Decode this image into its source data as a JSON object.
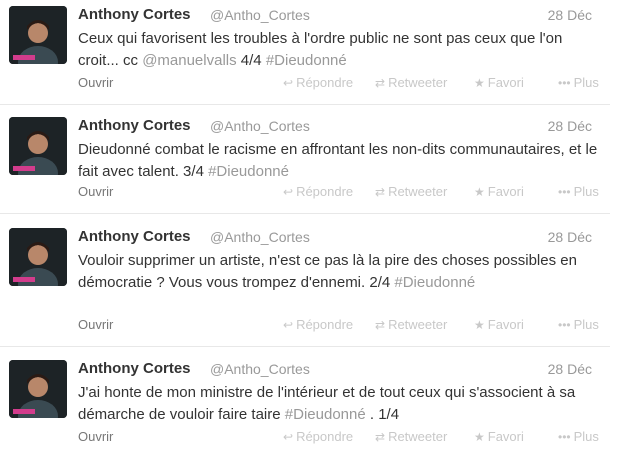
{
  "author": {
    "name": "Anthony Cortes",
    "handle": "@Antho_Cortes"
  },
  "actions": {
    "open": "Ouvrir",
    "reply": "Répondre",
    "retweet": "Retweeter",
    "favorite": "Favori",
    "more": "Plus"
  },
  "tweets": [
    {
      "date": "28 Déc",
      "text_main": "Ceux qui favorisent les troubles à l'ordre public ne sont pas ceux que l'on croit... cc ",
      "mention": "@manuelvalls",
      "text_after": " 4/4 ",
      "hashtag": "#Dieudonné"
    },
    {
      "date": "28 Déc",
      "text_main": "Dieudonné combat le racisme en affrontant les non-dits communautaires, et le fait avec talent. 3/4 ",
      "hashtag": "#Dieudonné"
    },
    {
      "date": "28 Déc",
      "text_main": "Vouloir supprimer un artiste, n'est ce pas là la pire des choses possibles en démocratie ? Vous vous trompez d'ennemi. 2/4 ",
      "hashtag": "#Dieudonné"
    },
    {
      "date": "28 Déc",
      "text_main": "J'ai honte de mon ministre de l'intérieur et de tout ceux qui s'associent à sa démarche de vouloir faire taire ",
      "hashtag": "#Dieudonné",
      "text_after": " . 1/4"
    }
  ]
}
